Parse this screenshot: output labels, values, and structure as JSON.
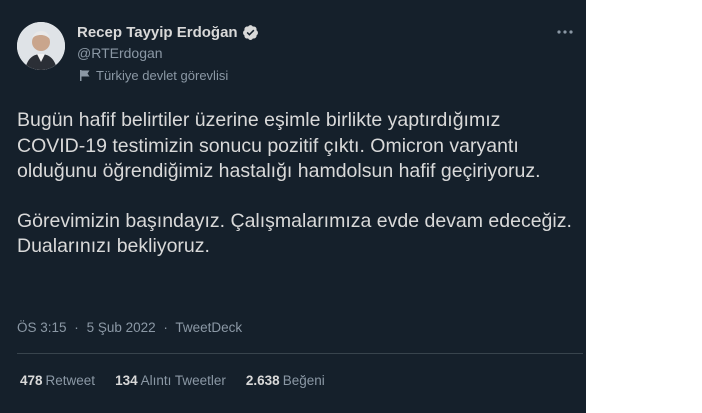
{
  "user": {
    "display_name": "Recep Tayyip Erdoğan",
    "handle": "@RTErdogan",
    "label": "Türkiye devlet görevlisi",
    "verified_color": "#d9d9d9"
  },
  "tweet": {
    "paragraph_1": "Bugün hafif belirtiler üzerine eşimle birlikte yaptırdığımız COVID-19 testimizin sonucu pozitif çıktı. Omicron varyantı olduğunu öğrendiğimiz hastalığı hamdolsun hafif geçiriyoruz.",
    "paragraph_2": "Görevimizin başındayız. Çalışmalarımıza evde devam edeceğiz. Dualarınızı bekliyoruz."
  },
  "meta": {
    "time": "ÖS 3:15",
    "date": "5 Şub 2022",
    "source": "TweetDeck",
    "separator": "·"
  },
  "stats": [
    {
      "count": "478",
      "label": "Retweet"
    },
    {
      "count": "134",
      "label": "Alıntı Tweetler"
    },
    {
      "count": "2.638",
      "label": "Beğeni"
    }
  ],
  "colors": {
    "background": "#15202b",
    "text": "#d9d9d9",
    "secondary": "#8b98a5",
    "divider": "#38444d"
  },
  "icons": {
    "more": "more-horizontal-icon",
    "verified": "verified-badge-icon",
    "label": "flag-icon"
  }
}
